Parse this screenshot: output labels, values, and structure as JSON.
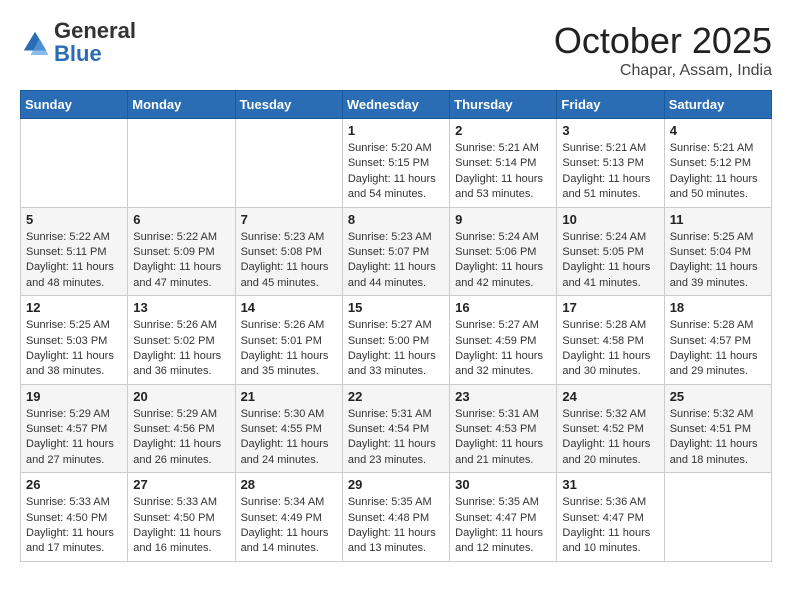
{
  "header": {
    "logo": {
      "general": "General",
      "blue": "Blue"
    },
    "title": "October 2025",
    "subtitle": "Chapar, Assam, India"
  },
  "days_of_week": [
    "Sunday",
    "Monday",
    "Tuesday",
    "Wednesday",
    "Thursday",
    "Friday",
    "Saturday"
  ],
  "weeks": [
    [
      {
        "day": "",
        "info": ""
      },
      {
        "day": "",
        "info": ""
      },
      {
        "day": "",
        "info": ""
      },
      {
        "day": "1",
        "info": "Sunrise: 5:20 AM\nSunset: 5:15 PM\nDaylight: 11 hours and 54 minutes."
      },
      {
        "day": "2",
        "info": "Sunrise: 5:21 AM\nSunset: 5:14 PM\nDaylight: 11 hours and 53 minutes."
      },
      {
        "day": "3",
        "info": "Sunrise: 5:21 AM\nSunset: 5:13 PM\nDaylight: 11 hours and 51 minutes."
      },
      {
        "day": "4",
        "info": "Sunrise: 5:21 AM\nSunset: 5:12 PM\nDaylight: 11 hours and 50 minutes."
      }
    ],
    [
      {
        "day": "5",
        "info": "Sunrise: 5:22 AM\nSunset: 5:11 PM\nDaylight: 11 hours and 48 minutes."
      },
      {
        "day": "6",
        "info": "Sunrise: 5:22 AM\nSunset: 5:09 PM\nDaylight: 11 hours and 47 minutes."
      },
      {
        "day": "7",
        "info": "Sunrise: 5:23 AM\nSunset: 5:08 PM\nDaylight: 11 hours and 45 minutes."
      },
      {
        "day": "8",
        "info": "Sunrise: 5:23 AM\nSunset: 5:07 PM\nDaylight: 11 hours and 44 minutes."
      },
      {
        "day": "9",
        "info": "Sunrise: 5:24 AM\nSunset: 5:06 PM\nDaylight: 11 hours and 42 minutes."
      },
      {
        "day": "10",
        "info": "Sunrise: 5:24 AM\nSunset: 5:05 PM\nDaylight: 11 hours and 41 minutes."
      },
      {
        "day": "11",
        "info": "Sunrise: 5:25 AM\nSunset: 5:04 PM\nDaylight: 11 hours and 39 minutes."
      }
    ],
    [
      {
        "day": "12",
        "info": "Sunrise: 5:25 AM\nSunset: 5:03 PM\nDaylight: 11 hours and 38 minutes."
      },
      {
        "day": "13",
        "info": "Sunrise: 5:26 AM\nSunset: 5:02 PM\nDaylight: 11 hours and 36 minutes."
      },
      {
        "day": "14",
        "info": "Sunrise: 5:26 AM\nSunset: 5:01 PM\nDaylight: 11 hours and 35 minutes."
      },
      {
        "day": "15",
        "info": "Sunrise: 5:27 AM\nSunset: 5:00 PM\nDaylight: 11 hours and 33 minutes."
      },
      {
        "day": "16",
        "info": "Sunrise: 5:27 AM\nSunset: 4:59 PM\nDaylight: 11 hours and 32 minutes."
      },
      {
        "day": "17",
        "info": "Sunrise: 5:28 AM\nSunset: 4:58 PM\nDaylight: 11 hours and 30 minutes."
      },
      {
        "day": "18",
        "info": "Sunrise: 5:28 AM\nSunset: 4:57 PM\nDaylight: 11 hours and 29 minutes."
      }
    ],
    [
      {
        "day": "19",
        "info": "Sunrise: 5:29 AM\nSunset: 4:57 PM\nDaylight: 11 hours and 27 minutes."
      },
      {
        "day": "20",
        "info": "Sunrise: 5:29 AM\nSunset: 4:56 PM\nDaylight: 11 hours and 26 minutes."
      },
      {
        "day": "21",
        "info": "Sunrise: 5:30 AM\nSunset: 4:55 PM\nDaylight: 11 hours and 24 minutes."
      },
      {
        "day": "22",
        "info": "Sunrise: 5:31 AM\nSunset: 4:54 PM\nDaylight: 11 hours and 23 minutes."
      },
      {
        "day": "23",
        "info": "Sunrise: 5:31 AM\nSunset: 4:53 PM\nDaylight: 11 hours and 21 minutes."
      },
      {
        "day": "24",
        "info": "Sunrise: 5:32 AM\nSunset: 4:52 PM\nDaylight: 11 hours and 20 minutes."
      },
      {
        "day": "25",
        "info": "Sunrise: 5:32 AM\nSunset: 4:51 PM\nDaylight: 11 hours and 18 minutes."
      }
    ],
    [
      {
        "day": "26",
        "info": "Sunrise: 5:33 AM\nSunset: 4:50 PM\nDaylight: 11 hours and 17 minutes."
      },
      {
        "day": "27",
        "info": "Sunrise: 5:33 AM\nSunset: 4:50 PM\nDaylight: 11 hours and 16 minutes."
      },
      {
        "day": "28",
        "info": "Sunrise: 5:34 AM\nSunset: 4:49 PM\nDaylight: 11 hours and 14 minutes."
      },
      {
        "day": "29",
        "info": "Sunrise: 5:35 AM\nSunset: 4:48 PM\nDaylight: 11 hours and 13 minutes."
      },
      {
        "day": "30",
        "info": "Sunrise: 5:35 AM\nSunset: 4:47 PM\nDaylight: 11 hours and 12 minutes."
      },
      {
        "day": "31",
        "info": "Sunrise: 5:36 AM\nSunset: 4:47 PM\nDaylight: 11 hours and 10 minutes."
      },
      {
        "day": "",
        "info": ""
      }
    ]
  ]
}
